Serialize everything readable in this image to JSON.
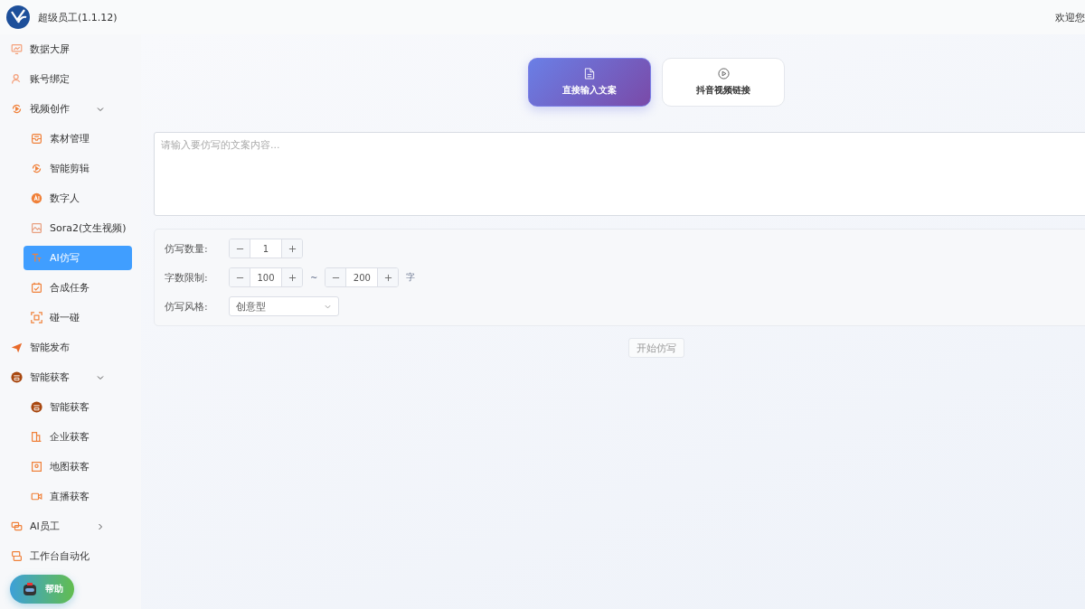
{
  "header": {
    "app_title": "超级员工(1.1.12)",
    "greeting": "欢迎您"
  },
  "sidebar": {
    "items": [
      {
        "label": "数据大屏",
        "selected": false
      },
      {
        "label": "账号绑定",
        "selected": false
      },
      {
        "label": "视频创作",
        "selected": false,
        "expanded": true,
        "children": [
          {
            "label": "素材管理",
            "selected": false
          },
          {
            "label": "智能剪辑",
            "selected": false
          },
          {
            "label": "数字人",
            "selected": false
          },
          {
            "label": "Sora2(文生视频)",
            "selected": false
          },
          {
            "label": "AI仿写",
            "selected": true
          },
          {
            "label": "合成任务",
            "selected": false
          },
          {
            "label": "碰一碰",
            "selected": false
          }
        ]
      },
      {
        "label": "智能发布",
        "selected": false
      },
      {
        "label": "智能获客",
        "selected": false,
        "expanded": true,
        "children": [
          {
            "label": "智能获客",
            "selected": false
          },
          {
            "label": "企业获客",
            "selected": false
          },
          {
            "label": "地图获客",
            "selected": false
          },
          {
            "label": "直播获客",
            "selected": false
          }
        ]
      },
      {
        "label": "AI员工",
        "selected": false,
        "expanded": false
      },
      {
        "label": "工作台自动化",
        "selected": false
      }
    ]
  },
  "help_button": {
    "label": "帮助"
  },
  "modes": [
    {
      "label": "直接输入文案",
      "selected": true
    },
    {
      "label": "抖音视频链接",
      "selected": false
    }
  ],
  "content_input": {
    "placeholder": "请输入要仿写的文案内容..."
  },
  "settings": {
    "count": {
      "label": "仿写数量:",
      "value": "1"
    },
    "length": {
      "label": "字数限制:",
      "min": "100",
      "separator": "~",
      "max": "200",
      "unit": "字"
    },
    "style": {
      "label": "仿写风格:",
      "value": "创意型"
    }
  },
  "start_button": {
    "label": "开始仿写",
    "disabled": true
  }
}
